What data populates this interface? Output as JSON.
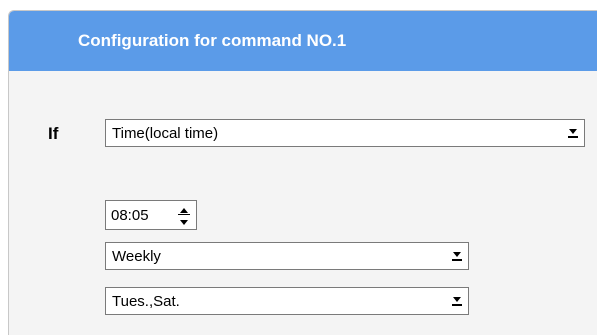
{
  "panel": {
    "title": "Configuration for command NO.1",
    "header_color": "#5b9be8"
  },
  "condition": {
    "label": "If",
    "selected": "Time(local time)"
  },
  "time": {
    "value": "08:05"
  },
  "frequency": {
    "selected": "Weekly"
  },
  "days": {
    "selected": "Tues.,Sat."
  },
  "icons": {
    "dropdown": "chevron-down-icon",
    "spin_up": "triangle-up-icon",
    "spin_down": "triangle-down-icon"
  }
}
